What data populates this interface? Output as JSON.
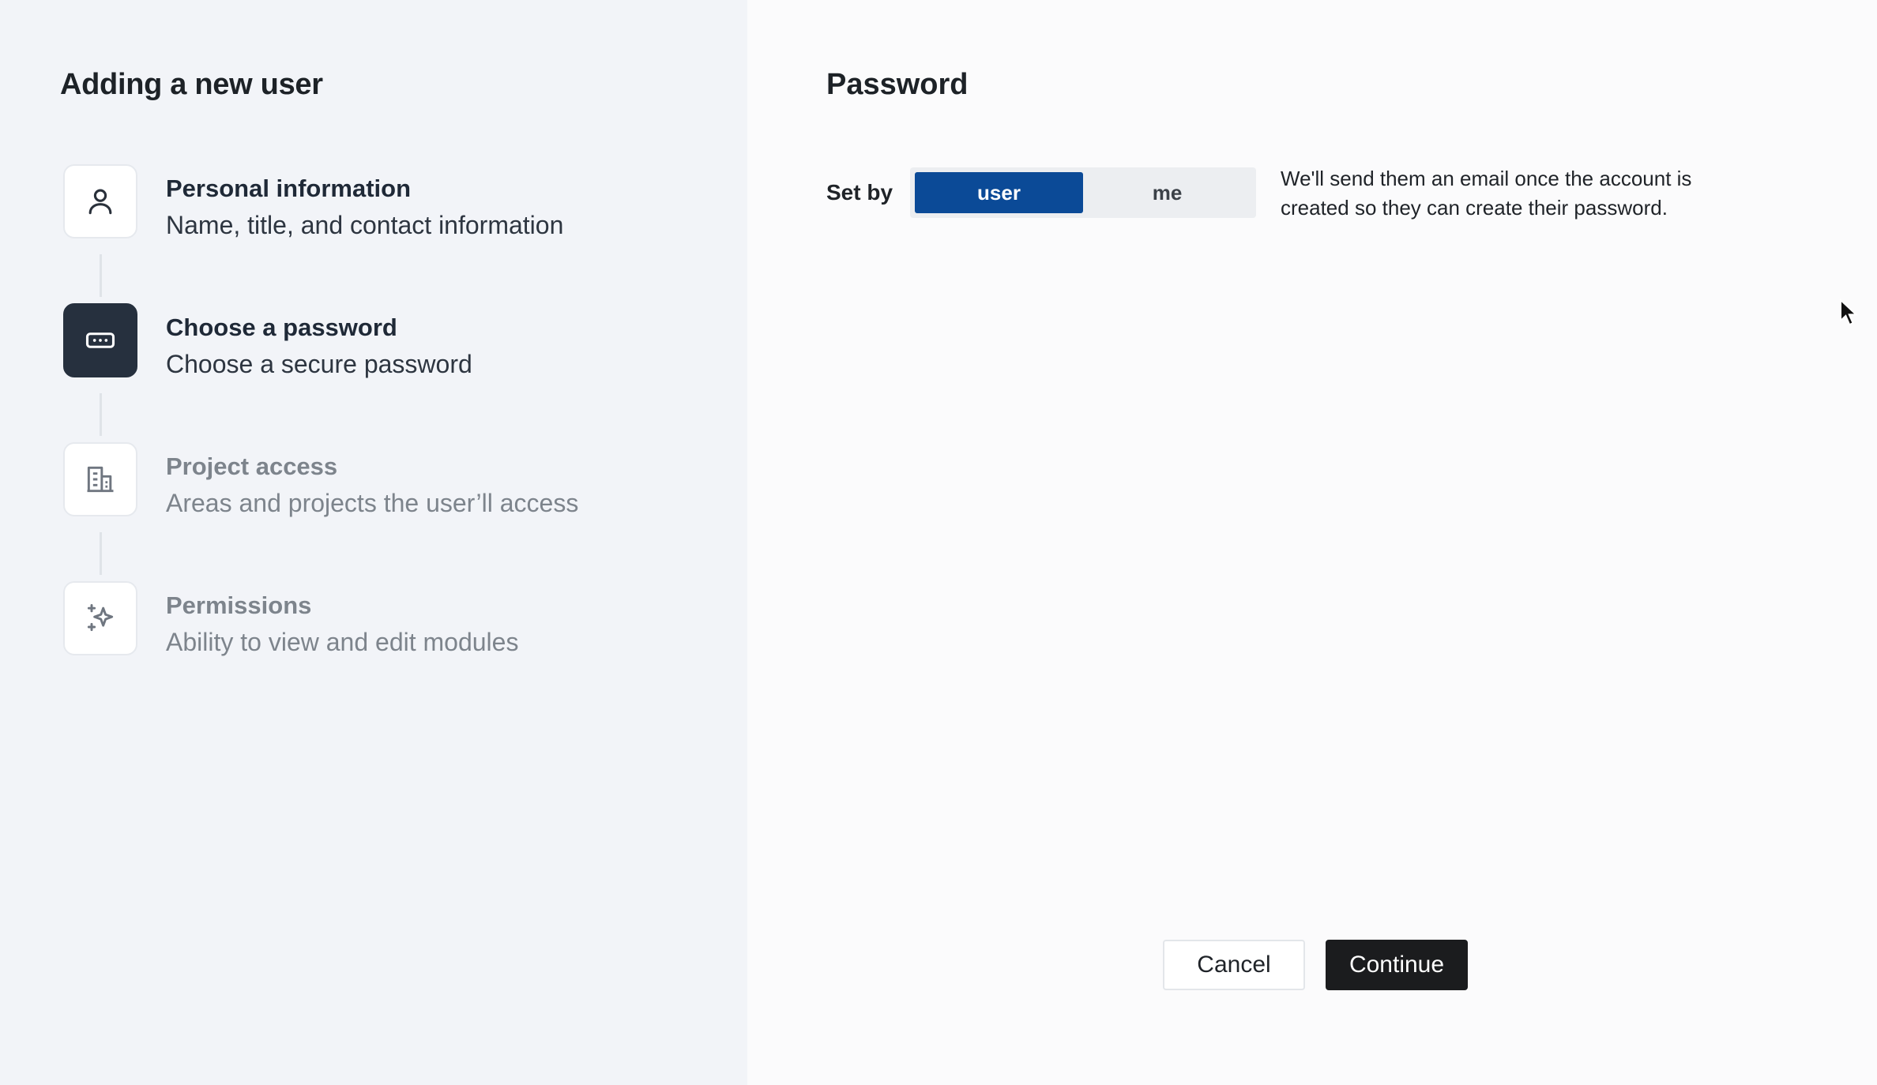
{
  "wizard": {
    "title": "Adding a new user",
    "steps": [
      {
        "title": "Personal information",
        "subtitle": "Name, title, and contact information",
        "icon": "user-icon",
        "state": "completed"
      },
      {
        "title": "Choose a password",
        "subtitle": "Choose a secure password",
        "icon": "password-dots-icon",
        "state": "active"
      },
      {
        "title": "Project access",
        "subtitle": "Areas and projects the user’ll access",
        "icon": "building-icon",
        "state": "upcoming"
      },
      {
        "title": "Permissions",
        "subtitle": "Ability to view and edit modules",
        "icon": "sparkle-icon",
        "state": "upcoming"
      }
    ]
  },
  "password": {
    "title": "Password",
    "set_by_label": "Set by",
    "options": [
      {
        "label": "user",
        "selected": true
      },
      {
        "label": "me",
        "selected": false
      }
    ],
    "helper": "We'll send them an email once the account is created so they can create their password."
  },
  "actions": {
    "cancel_label": "Cancel",
    "continue_label": "Continue"
  },
  "colors": {
    "left_panel_bg": "#f2f4f8",
    "right_panel_bg": "#fbfbfc",
    "active_step_icon_bg": "#26303e",
    "segment_selected": "#0b4a97",
    "primary_button": "#1b1c1e"
  }
}
